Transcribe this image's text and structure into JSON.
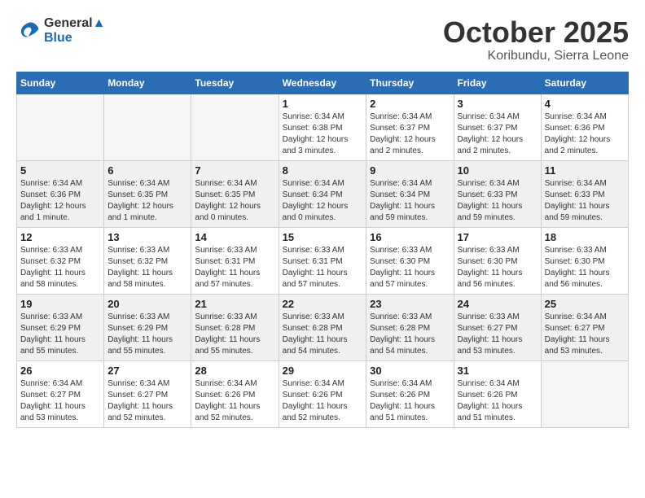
{
  "header": {
    "logo_line1": "General",
    "logo_line2": "Blue",
    "month_title": "October 2025",
    "location": "Koribundu, Sierra Leone"
  },
  "days_of_week": [
    "Sunday",
    "Monday",
    "Tuesday",
    "Wednesday",
    "Thursday",
    "Friday",
    "Saturday"
  ],
  "weeks": [
    [
      {
        "num": "",
        "info": ""
      },
      {
        "num": "",
        "info": ""
      },
      {
        "num": "",
        "info": ""
      },
      {
        "num": "1",
        "info": "Sunrise: 6:34 AM\nSunset: 6:38 PM\nDaylight: 12 hours and 3 minutes."
      },
      {
        "num": "2",
        "info": "Sunrise: 6:34 AM\nSunset: 6:37 PM\nDaylight: 12 hours and 2 minutes."
      },
      {
        "num": "3",
        "info": "Sunrise: 6:34 AM\nSunset: 6:37 PM\nDaylight: 12 hours and 2 minutes."
      },
      {
        "num": "4",
        "info": "Sunrise: 6:34 AM\nSunset: 6:36 PM\nDaylight: 12 hours and 2 minutes."
      }
    ],
    [
      {
        "num": "5",
        "info": "Sunrise: 6:34 AM\nSunset: 6:36 PM\nDaylight: 12 hours and 1 minute."
      },
      {
        "num": "6",
        "info": "Sunrise: 6:34 AM\nSunset: 6:35 PM\nDaylight: 12 hours and 1 minute."
      },
      {
        "num": "7",
        "info": "Sunrise: 6:34 AM\nSunset: 6:35 PM\nDaylight: 12 hours and 0 minutes."
      },
      {
        "num": "8",
        "info": "Sunrise: 6:34 AM\nSunset: 6:34 PM\nDaylight: 12 hours and 0 minutes."
      },
      {
        "num": "9",
        "info": "Sunrise: 6:34 AM\nSunset: 6:34 PM\nDaylight: 11 hours and 59 minutes."
      },
      {
        "num": "10",
        "info": "Sunrise: 6:34 AM\nSunset: 6:33 PM\nDaylight: 11 hours and 59 minutes."
      },
      {
        "num": "11",
        "info": "Sunrise: 6:34 AM\nSunset: 6:33 PM\nDaylight: 11 hours and 59 minutes."
      }
    ],
    [
      {
        "num": "12",
        "info": "Sunrise: 6:33 AM\nSunset: 6:32 PM\nDaylight: 11 hours and 58 minutes."
      },
      {
        "num": "13",
        "info": "Sunrise: 6:33 AM\nSunset: 6:32 PM\nDaylight: 11 hours and 58 minutes."
      },
      {
        "num": "14",
        "info": "Sunrise: 6:33 AM\nSunset: 6:31 PM\nDaylight: 11 hours and 57 minutes."
      },
      {
        "num": "15",
        "info": "Sunrise: 6:33 AM\nSunset: 6:31 PM\nDaylight: 11 hours and 57 minutes."
      },
      {
        "num": "16",
        "info": "Sunrise: 6:33 AM\nSunset: 6:30 PM\nDaylight: 11 hours and 57 minutes."
      },
      {
        "num": "17",
        "info": "Sunrise: 6:33 AM\nSunset: 6:30 PM\nDaylight: 11 hours and 56 minutes."
      },
      {
        "num": "18",
        "info": "Sunrise: 6:33 AM\nSunset: 6:30 PM\nDaylight: 11 hours and 56 minutes."
      }
    ],
    [
      {
        "num": "19",
        "info": "Sunrise: 6:33 AM\nSunset: 6:29 PM\nDaylight: 11 hours and 55 minutes."
      },
      {
        "num": "20",
        "info": "Sunrise: 6:33 AM\nSunset: 6:29 PM\nDaylight: 11 hours and 55 minutes."
      },
      {
        "num": "21",
        "info": "Sunrise: 6:33 AM\nSunset: 6:28 PM\nDaylight: 11 hours and 55 minutes."
      },
      {
        "num": "22",
        "info": "Sunrise: 6:33 AM\nSunset: 6:28 PM\nDaylight: 11 hours and 54 minutes."
      },
      {
        "num": "23",
        "info": "Sunrise: 6:33 AM\nSunset: 6:28 PM\nDaylight: 11 hours and 54 minutes."
      },
      {
        "num": "24",
        "info": "Sunrise: 6:33 AM\nSunset: 6:27 PM\nDaylight: 11 hours and 53 minutes."
      },
      {
        "num": "25",
        "info": "Sunrise: 6:34 AM\nSunset: 6:27 PM\nDaylight: 11 hours and 53 minutes."
      }
    ],
    [
      {
        "num": "26",
        "info": "Sunrise: 6:34 AM\nSunset: 6:27 PM\nDaylight: 11 hours and 53 minutes."
      },
      {
        "num": "27",
        "info": "Sunrise: 6:34 AM\nSunset: 6:27 PM\nDaylight: 11 hours and 52 minutes."
      },
      {
        "num": "28",
        "info": "Sunrise: 6:34 AM\nSunset: 6:26 PM\nDaylight: 11 hours and 52 minutes."
      },
      {
        "num": "29",
        "info": "Sunrise: 6:34 AM\nSunset: 6:26 PM\nDaylight: 11 hours and 52 minutes."
      },
      {
        "num": "30",
        "info": "Sunrise: 6:34 AM\nSunset: 6:26 PM\nDaylight: 11 hours and 51 minutes."
      },
      {
        "num": "31",
        "info": "Sunrise: 6:34 AM\nSunset: 6:26 PM\nDaylight: 11 hours and 51 minutes."
      },
      {
        "num": "",
        "info": ""
      }
    ]
  ]
}
